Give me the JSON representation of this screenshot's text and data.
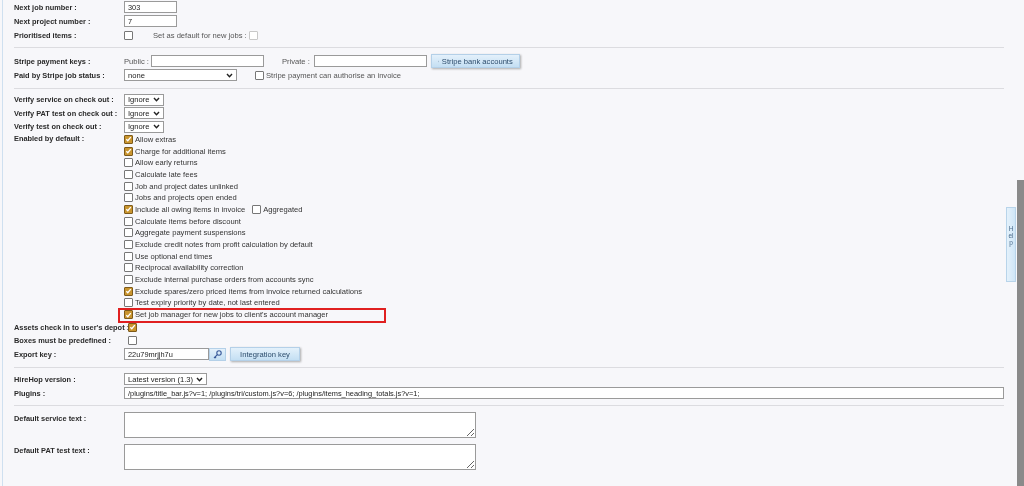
{
  "sections": [
    {
      "rows": [
        {
          "kind": "input",
          "label": "Next job number :",
          "value": "303"
        },
        {
          "kind": "input",
          "label": "Next project number :",
          "value": "7"
        },
        {
          "kind": "check_pair",
          "label": "Prioritised items :",
          "checked": false,
          "second_label": "Set as default for new jobs :",
          "second_checked": false,
          "second_disabled": true
        }
      ]
    },
    {
      "rows": [
        {
          "kind": "stripe_keys",
          "label": "Stripe payment keys :",
          "public_label": "Public :",
          "public_value": "",
          "private_label": "Private :",
          "private_value": "",
          "button": "Stripe bank accounts"
        },
        {
          "kind": "select_check",
          "label": "Paid by Stripe job status :",
          "value": "none",
          "check_label": "Stripe payment can authorise an invoice",
          "checked": false
        }
      ]
    },
    {
      "rows": [
        {
          "kind": "select",
          "label": "Verify service on check out :",
          "value": "Ignore"
        },
        {
          "kind": "select",
          "label": "Verify PAT test on check out :",
          "value": "Ignore"
        },
        {
          "kind": "select",
          "label": "Verify test on check out :",
          "value": "Ignore"
        },
        {
          "kind": "checklist",
          "label": "Enabled by default :",
          "items": [
            {
              "label": "Allow extras",
              "checked": true
            },
            {
              "label": "Charge for additional items",
              "checked": true
            },
            {
              "label": "Allow early returns",
              "checked": false
            },
            {
              "label": "Calculate late fees",
              "checked": false
            },
            {
              "label": "Job and project dates unlinked",
              "checked": false
            },
            {
              "label": "Jobs and projects open ended",
              "checked": false
            },
            {
              "label": "Include all owing items in invoice",
              "checked": true,
              "extra": {
                "label": "Aggregated",
                "checked": false
              }
            },
            {
              "label": "Calculate items before discount",
              "checked": false
            },
            {
              "label": "Aggregate payment suspensions",
              "checked": false
            },
            {
              "label": "Exclude credit notes from profit calculation by default",
              "checked": false
            },
            {
              "label": "Use optional end times",
              "checked": false
            },
            {
              "label": "Reciprocal availability correction",
              "checked": false
            },
            {
              "label": "Exclude internal purchase orders from accounts sync",
              "checked": false
            },
            {
              "label": "Exclude spares/zero priced items from invoice returned calculations",
              "checked": true
            },
            {
              "label": "Test expiry priority by date, not last entered",
              "checked": false
            },
            {
              "label": "Set job manager for new jobs to client's account manager",
              "checked": true,
              "highlighted": true
            }
          ]
        },
        {
          "kind": "checkbox",
          "label": "Assets check in to user's depot :",
          "checked": true
        },
        {
          "kind": "checkbox",
          "label": "Boxes must be predefined :",
          "checked": false
        },
        {
          "kind": "key",
          "label": "Export key :",
          "value": "22u79mrjjh7u",
          "button": "Integration key"
        }
      ]
    },
    {
      "rows": [
        {
          "kind": "select",
          "label": "HireHop version :",
          "value": "Latest version (1.3)"
        },
        {
          "kind": "wide_input",
          "label": "Plugins :",
          "value": "/plugins/title_bar.js?v=1; /plugins/tri/custom.js?v=6; /plugins/items_heading_totals.js?v=1;"
        }
      ]
    },
    {
      "rows": [
        {
          "kind": "textarea",
          "label": "Default service text :",
          "value": ""
        },
        {
          "kind": "textarea",
          "label": "Default PAT test text :",
          "value": ""
        }
      ]
    }
  ],
  "help_tab": "Help"
}
